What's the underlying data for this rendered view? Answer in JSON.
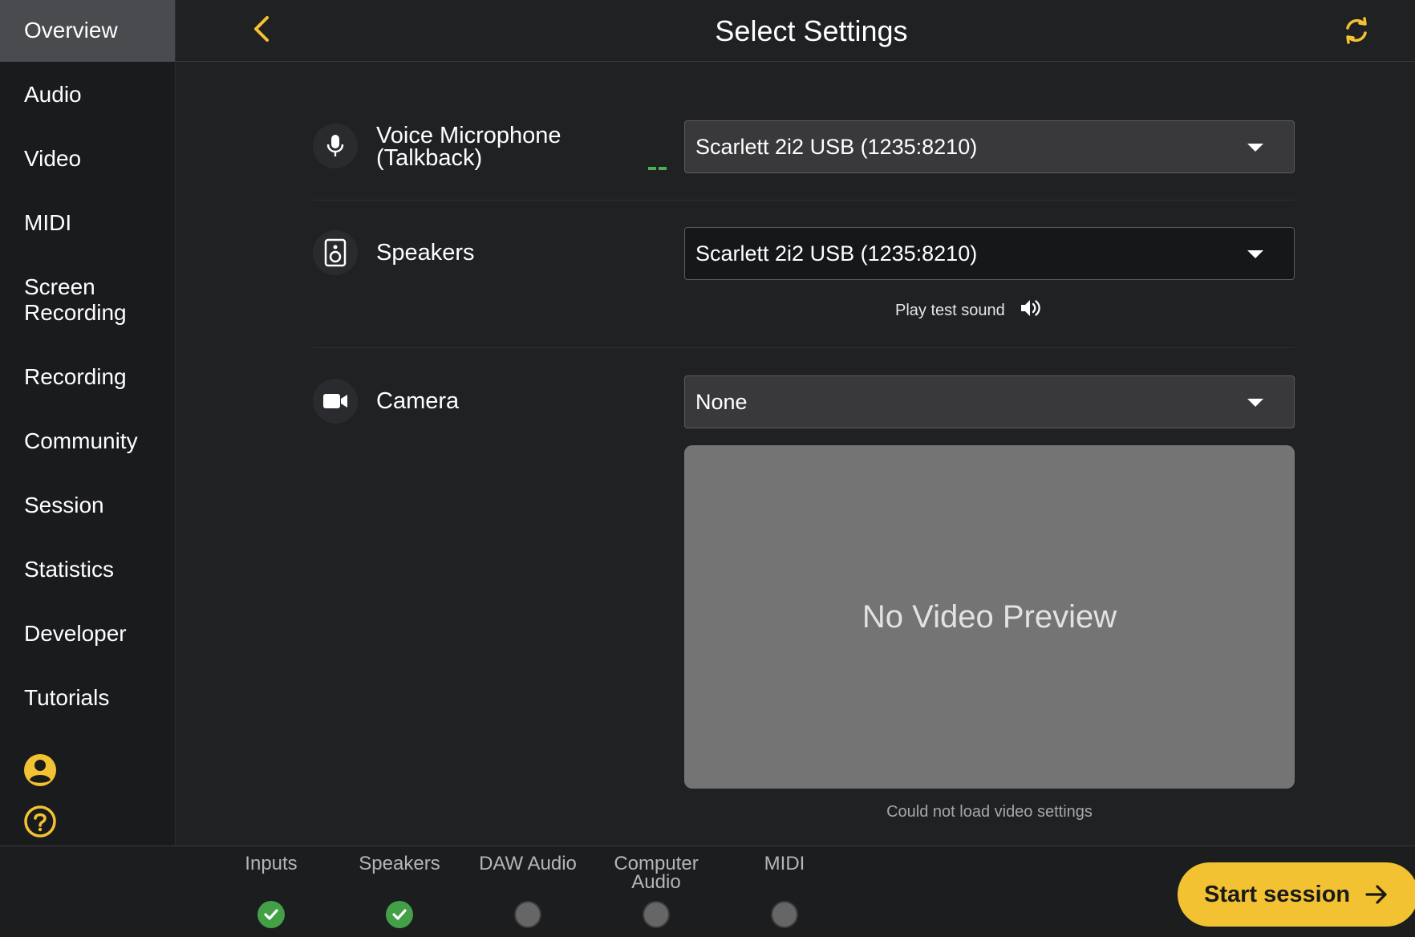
{
  "sidebar": {
    "items": [
      {
        "label": "Overview"
      },
      {
        "label": "Audio"
      },
      {
        "label": "Video"
      },
      {
        "label": "MIDI"
      },
      {
        "label": "Screen Recording"
      },
      {
        "label": "Recording"
      },
      {
        "label": "Community"
      },
      {
        "label": "Session"
      },
      {
        "label": "Statistics"
      },
      {
        "label": "Developer"
      },
      {
        "label": "Tutorials"
      }
    ],
    "active": "Overview",
    "bottom_icons": [
      "account-icon",
      "help-icon"
    ]
  },
  "header": {
    "title": "Select Settings",
    "back_icon": "chevron-left-icon",
    "refresh_icon": "refresh-icon"
  },
  "settings": {
    "microphone": {
      "label_line1": "Voice Microphone",
      "label_line2": "(Talkback)",
      "value": "Scarlett 2i2 USB (1235:8210)",
      "icon": "microphone-icon"
    },
    "speakers": {
      "label": "Speakers",
      "value": "Scarlett 2i2 USB (1235:8210)",
      "icon": "speaker-icon",
      "test_label": "Play test sound"
    },
    "camera": {
      "label": "Camera",
      "value": "None",
      "icon": "camera-icon",
      "preview_text": "No Video Preview",
      "message": "Could not load video settings"
    }
  },
  "footer": {
    "steps": [
      {
        "label_line1": "Inputs",
        "label_line2": "",
        "done": true
      },
      {
        "label_line1": "Speakers",
        "label_line2": "",
        "done": true
      },
      {
        "label_line1": "DAW Audio",
        "label_line2": "",
        "done": false
      },
      {
        "label_line1": "Computer",
        "label_line2": "Audio",
        "done": false
      },
      {
        "label_line1": "MIDI",
        "label_line2": "",
        "done": false
      }
    ],
    "start_label": "Start session"
  },
  "colors": {
    "accent": "#f2c232",
    "done": "#43a047",
    "level": "#4caf50"
  }
}
